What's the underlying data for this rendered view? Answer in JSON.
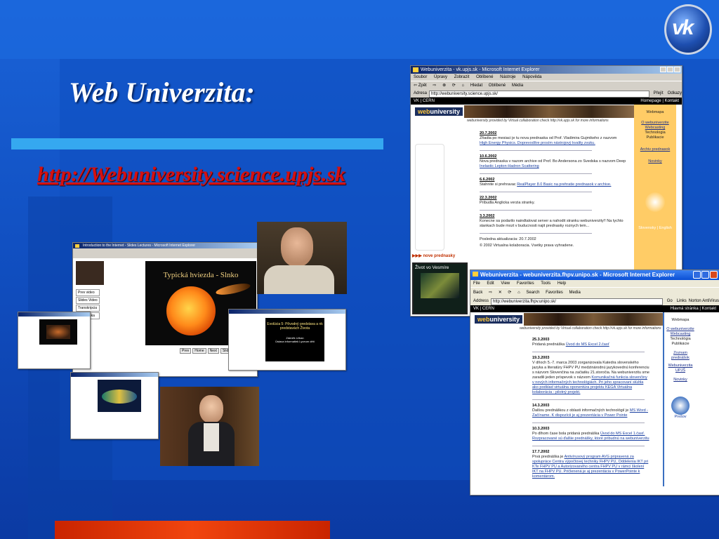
{
  "slide": {
    "title": "Web Univerzita:",
    "url": "http://Webuniversity.science.upjs.sk",
    "logo_text": "vk",
    "colors": {
      "background": "#1150c2",
      "cyan_bar": "#35a8f0",
      "orange_bar": "#f1450e",
      "url_red": "#d61010"
    }
  },
  "window1": {
    "title": "Webuniverzita - vk.upjs.sk - Microsoft Internet Explorer",
    "menu": [
      "Soubor",
      "Úpravy",
      "Zobrazit",
      "Oblíbené",
      "Nástroje",
      "Nápověda"
    ],
    "toolbar": [
      "⇦ Zpět",
      "⇨",
      "⊗",
      "⟳",
      "⌂",
      "Hledat",
      "Oblíbené",
      "Média"
    ],
    "address_label": "Adresa",
    "address": "http://webuniversity.science.upjs.sk/",
    "go": "Přejít",
    "links": "Odkazy",
    "top_left": "VK | CERN",
    "top_right": "Homepage | Kontakt",
    "logo_web": "web",
    "logo_univ": "university",
    "tagline": "webuniversity provided by Virtual collaboration check http://vk.upjs.sk for more informations",
    "news": [
      {
        "date": "20.7.2002",
        "text": "Zřiadia po mesiaci je tu nova prednaska od Prof. Vladimira Gujmikeho z nazvom",
        "link": "High Energy Physics. Doprevodítre prosím nástrojový kvality zvuku."
      },
      {
        "date": "10.6.2002",
        "text": "Nova prednaska v nazom archive od Prof. Bo Andersona zo Svedska s nazvom Deep",
        "link": "Inelastic Lepton-Hadron Scattering"
      },
      {
        "date": "6.6.2002",
        "text": "Stahnite si prehravac",
        "link": "RealPlayer 8.0 Basic na prehratie prednasok v archive."
      },
      {
        "date": "22.3.2002",
        "text": "Pribudla Anglicka verzia stranky.",
        "link": ""
      },
      {
        "date": "3.3.2002",
        "text": "Konecne sa podarilo naindtalovat server a nahodit stranku webuniverzity!! Na tychto",
        "link": "stankach bude mozt v buducnosti najit prednasky roznych tem..."
      }
    ],
    "updated": "Posledna aktualizacia: 20.7.2002",
    "copyright": "© 2002 Virtualna kolaboracia. Vsetky prava vyhradene.",
    "side_links": [
      "Webmapa",
      "O webuniverzite",
      "Webcasting",
      "Technologia",
      "Publikacie",
      "Archiv prednasok",
      "Novinky"
    ],
    "side_bottom": "Slovensky | English",
    "nove_prednasky": "nove prednasky",
    "zivot": "Život vo Vesmíre"
  },
  "window2": {
    "title": "Webuniverzita - webuniverzita.fhpv.unipo.sk - Microsoft Internet Explorer",
    "menu": [
      "File",
      "Edit",
      "View",
      "Favorites",
      "Tools",
      "Help"
    ],
    "toolbar": [
      "Back",
      "⇨",
      "✕",
      "⟳",
      "⌂",
      "Search",
      "Favorites",
      "Media"
    ],
    "address_label": "Address",
    "address": "http://webuniverzita.fhpv.unipo.sk/",
    "go": "Go",
    "links": "Links",
    "norton": "Norton AntiVirus",
    "top_left": "VK | CERN",
    "top_right": "Hlavná stránka | Kontakt",
    "logo_web": "web",
    "logo_univ": "university",
    "tagline": "webuniversity provided by Virtual collaboration check http://vk.upjs.sk for more informations",
    "news": [
      {
        "date": "25.3.2003",
        "text": "Pridaná prednáška",
        "link": "Úvod do MS Excel 2.časť"
      },
      {
        "date": "19.3.2003",
        "text": "V dňoch 5.-7. marca 2003 zorganizovala Katedra slovenského jazyka a literatúry FHPV PU medzinárodnú jazykovednú konferenciu s názvom Slovenčina na začiatku 21.storočia. Na webuniverzitu sme zaradili jeden príspevok s názvom",
        "link": "Komunikačná funkcia slovenčiny v nových informačných technológiách. Pri jeho spracovaní slúžila ako podklad virtuálna oponentúra projektu KEGA Virtuálna kolaborácia - pilotný projekt."
      },
      {
        "date": "14.3.2003",
        "text": "Ďalšou prednáškou z oblasti informačných technológií je",
        "link": "MS Word - Začíname. K dispozícii je aj prezentácia v Power Pointe"
      },
      {
        "date": "10.3.2003",
        "text": "Po dlhom čase bola pridaná prednáška",
        "link": "Úvod do MS Excel 1.časť. Rozpracované sú ďalšie prednášky, ktoré pribudnú na webuniverzitu"
      },
      {
        "date": "17.7.2002",
        "text": "Prvá prednáška je",
        "link": "Antivírusový program AVG pripravená za spolupráce Centra výpočtovej techniky FHPV PU, Oddelenia IKT pri KTe FHPV PU a Autorizovaného centra FHPV PU v rámci školení IKT na FHPV PU. Pričlenená je aj prezentácia v PowerPointe k komentárom."
      }
    ],
    "side_links": [
      "Webmapa",
      "O webuniverzite",
      "Webcasting",
      "Technológia",
      "Publikácie",
      "Zoznam prednášok",
      "Webuniverzita UPJŠ",
      "Novinky"
    ],
    "side_bottom": "Prešov"
  },
  "small_windows": {
    "main_title": "Introduction to the Internet - Slides Lectures - Microsoft Internet Explorer",
    "slide_text": "Typická hviezda - Slnko",
    "evolution_title": "Evolúcia 5: Pôvodný predstava a nk predstavách Života",
    "evolution_sub": "Zdeněk Urban",
    "evolution_sub2": "Ústava informatiek Lyceum dětí",
    "buttons": [
      "Prev",
      "Home",
      "Next",
      "Slide Video"
    ],
    "dialog_labels": [
      "Prev video",
      "Slides Video",
      "Transkripcia",
      "Prednáška"
    ]
  }
}
